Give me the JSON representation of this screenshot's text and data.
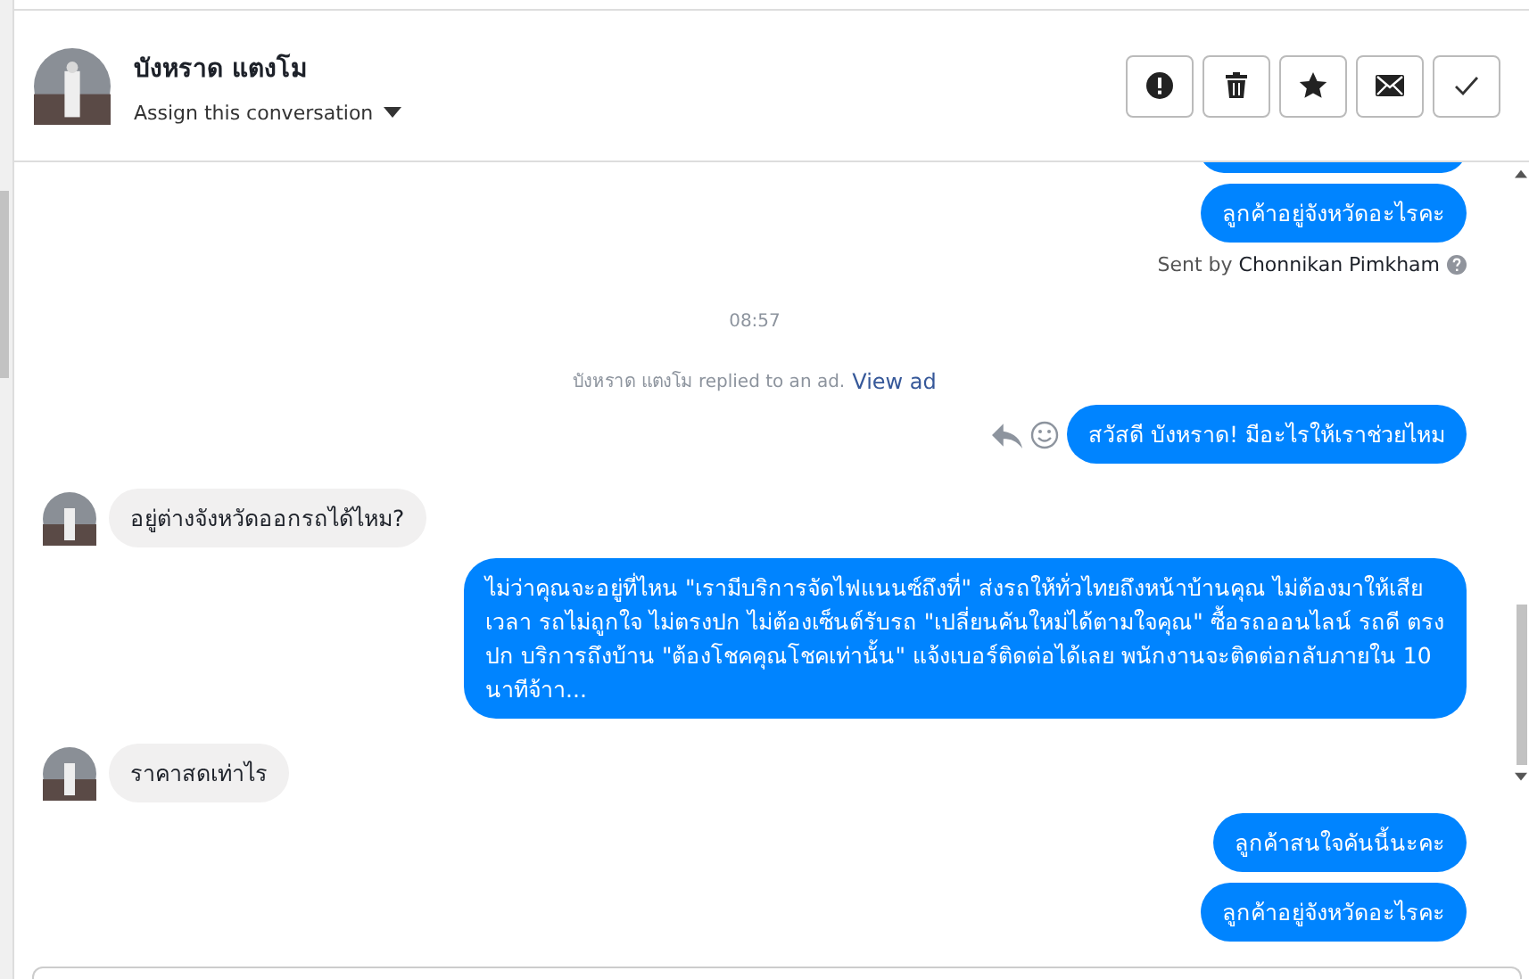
{
  "header": {
    "name": "บังหราด แตงโม",
    "assign": "Assign this conversation",
    "actions": [
      {
        "kind": "spam"
      },
      {
        "kind": "delete"
      },
      {
        "kind": "star"
      },
      {
        "kind": "mail"
      },
      {
        "kind": "done"
      }
    ]
  },
  "messages": [
    {
      "kind": "outgoing-cut-top"
    },
    {
      "kind": "outgoing",
      "text": "ลูกค้าอยู่จังหวัดอะไรคะ"
    },
    {
      "kind": "sent-by",
      "prefix": "Sent by",
      "agent": "Chonnikan Pimkham"
    },
    {
      "kind": "time",
      "text": "08:57"
    },
    {
      "kind": "notice",
      "text": "บังหราด แตงโม replied to an ad.",
      "link": "View ad"
    },
    {
      "kind": "outgoing",
      "text": "สวัสดี บังหราด! มีอะไรให้เราช่วยไหม",
      "actions": true
    },
    {
      "kind": "incoming",
      "text": "อยู่ต่างจังหวัดออกรถได้ไหม?"
    },
    {
      "kind": "outgoing",
      "text": "ไม่ว่าคุณจะอยู่ที่ไหน \"เรามีบริการจัดไฟแนนซ์ถึงที่\"  ส่งรถให้ทั่วไทยถึงหน้าบ้านคุณ ไม่ต้องมาให้เสียเวลา รถไม่ถูกใจ ไม่ตรงปก ไม่ต้องเซ็นต์รับรถ \"เปลี่ยนคันใหม่ได้ตามใจคุณ\" ซื้อรถออนไลน์ รถดี ตรงปก บริการถึงบ้าน \"ต้องโชคคุณโชคเท่านั้น\" แจ้งเบอร์ติดต่อได้เลย พนักงานจะติดต่อกลับภายใน 10 นาทีจ้าา..."
    },
    {
      "kind": "incoming",
      "text": "ราคาสดเท่าไร"
    },
    {
      "kind": "outgoing",
      "text": "ลูกค้าสนใจคันนี้นะคะ"
    },
    {
      "kind": "outgoing",
      "text": "ลูกค้าอยู่จังหวัดอะไรคะ"
    }
  ]
}
